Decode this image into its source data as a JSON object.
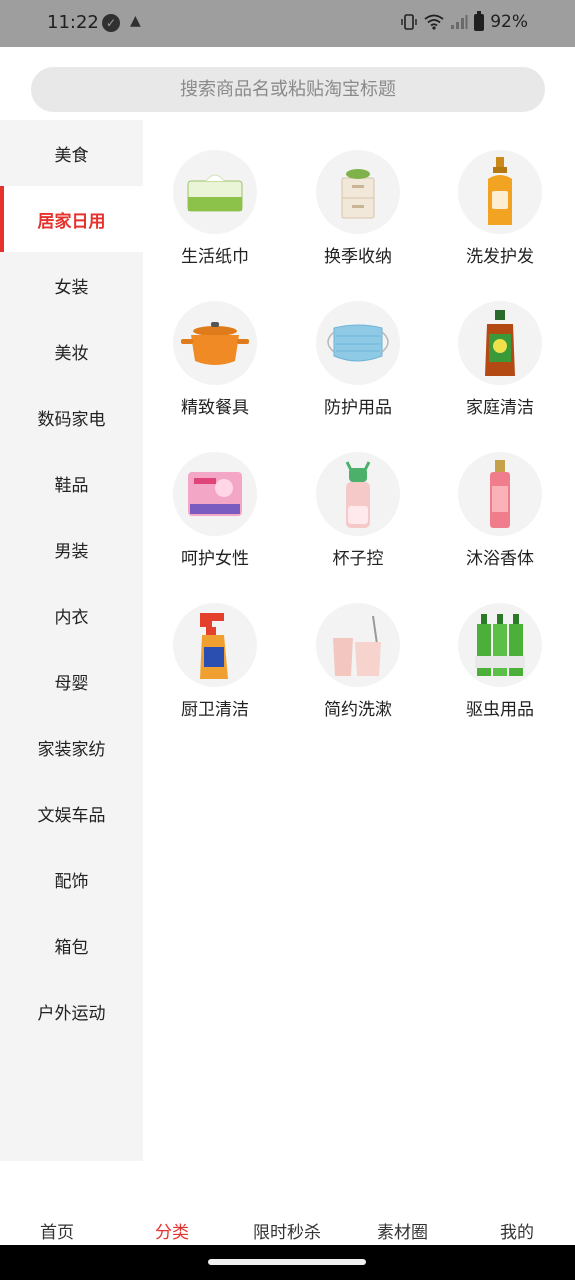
{
  "status_bar": {
    "time": "11:22",
    "battery": "92%",
    "icons": [
      "check-circle-icon",
      "warning-icon",
      "vibrate-icon",
      "wifi-icon",
      "signal-icon",
      "battery-icon"
    ]
  },
  "search": {
    "placeholder": "搜索商品名或粘贴淘宝标题"
  },
  "sidebar": {
    "active_index": 1,
    "items": [
      {
        "label": "美食"
      },
      {
        "label": "居家日用"
      },
      {
        "label": "女装"
      },
      {
        "label": "美妆"
      },
      {
        "label": "数码家电"
      },
      {
        "label": "鞋品"
      },
      {
        "label": "男装"
      },
      {
        "label": "内衣"
      },
      {
        "label": "母婴"
      },
      {
        "label": "家装家纺"
      },
      {
        "label": "文娱车品"
      },
      {
        "label": "配饰"
      },
      {
        "label": "箱包"
      },
      {
        "label": "户外运动"
      }
    ]
  },
  "categories": [
    {
      "label": "生活纸巾",
      "icon": "tissue-box-icon"
    },
    {
      "label": "换季收纳",
      "icon": "storage-drawer-icon"
    },
    {
      "label": "洗发护发",
      "icon": "shampoo-bottle-icon"
    },
    {
      "label": "精致餐具",
      "icon": "cooking-pot-icon"
    },
    {
      "label": "防护用品",
      "icon": "face-mask-icon"
    },
    {
      "label": "家庭清洁",
      "icon": "disinfectant-bottle-icon"
    },
    {
      "label": "呵护女性",
      "icon": "sanitary-pad-icon"
    },
    {
      "label": "杯子控",
      "icon": "water-bottle-icon"
    },
    {
      "label": "沐浴香体",
      "icon": "body-mist-icon"
    },
    {
      "label": "厨卫清洁",
      "icon": "spray-cleaner-icon"
    },
    {
      "label": "简约洗漱",
      "icon": "toothbrush-cup-icon"
    },
    {
      "label": "驱虫用品",
      "icon": "repellent-bottles-icon"
    }
  ],
  "bottom_nav": {
    "active_index": 1,
    "items": [
      {
        "label": "首页"
      },
      {
        "label": "分类"
      },
      {
        "label": "限时秒杀"
      },
      {
        "label": "素材圈"
      },
      {
        "label": "我的"
      }
    ]
  },
  "colors": {
    "accent": "#e5322d",
    "sidebar_bg": "#f4f4f4",
    "status_bar_bg": "#9e9e9e"
  }
}
